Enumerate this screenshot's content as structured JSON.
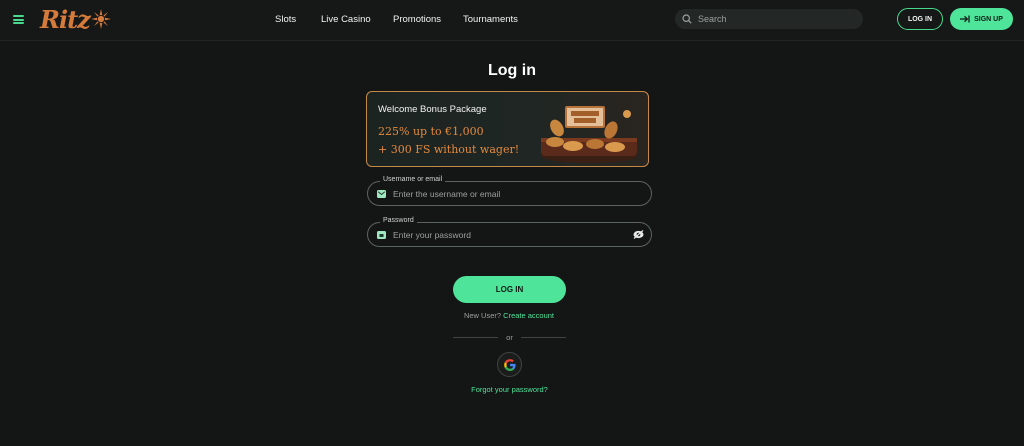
{
  "header": {
    "logo_text": "Ritz",
    "nav": [
      {
        "label": "Slots"
      },
      {
        "label": "Live Casino"
      },
      {
        "label": "Promotions"
      },
      {
        "label": "Tournaments"
      }
    ],
    "search_placeholder": "Search",
    "login_label": "LOG IN",
    "signup_label": "SIGN UP"
  },
  "login": {
    "title": "Log in",
    "bonus": {
      "title": "Welcome Bonus Package",
      "line1": "225% up to €1,000",
      "line2": "+ 300 FS without wager!"
    },
    "username": {
      "label": "Username or email",
      "placeholder": "Enter the username or email"
    },
    "password": {
      "label": "Password",
      "placeholder": "Enter your password"
    },
    "submit_label": "LOG IN",
    "new_user_text": "New User?",
    "create_account": "Create account",
    "or_text": "or",
    "forgot": "Forgot your password?"
  },
  "icons": [
    "hamburger-icon",
    "search-icon",
    "signup-arrow-icon",
    "mail-icon",
    "lock-icon",
    "eye-icon",
    "google-icon"
  ],
  "colors": {
    "accent": "#4ee49a",
    "background": "#141515",
    "bonus_border": "#c58a46",
    "bonus_text": "#e48a3c",
    "logo": "#d47a3a"
  }
}
